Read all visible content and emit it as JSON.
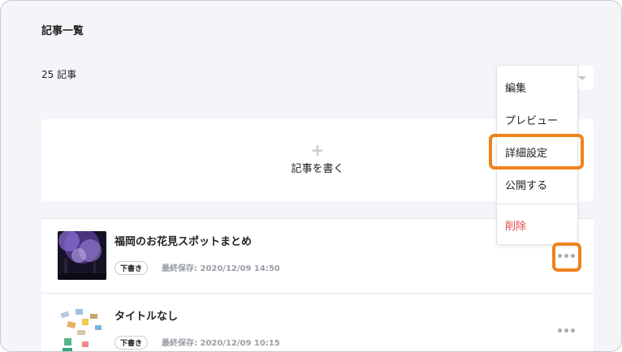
{
  "page": {
    "title": "記事一覧",
    "article_count": "25 記事"
  },
  "new_article": {
    "plus": "+",
    "label": "記事を書く"
  },
  "dropdown_menu": {
    "items": [
      {
        "label": "編集"
      },
      {
        "label": "プレビュー"
      },
      {
        "label": "詳細設定"
      },
      {
        "label": "公開する"
      },
      {
        "label": "削除",
        "color": "#e24a4a"
      }
    ]
  },
  "articles": [
    {
      "title": "福岡のお花見スポットまとめ",
      "status": "下書き",
      "saved": "最終保存: 2020/12/09 14:50"
    },
    {
      "title": "タイトルなし",
      "status": "下書き",
      "saved": "最終保存: 2020/12/09 10:15"
    }
  ],
  "colors": {
    "highlight": "#f0821e",
    "background": "#f4f5f9",
    "danger": "#e24a4a"
  }
}
